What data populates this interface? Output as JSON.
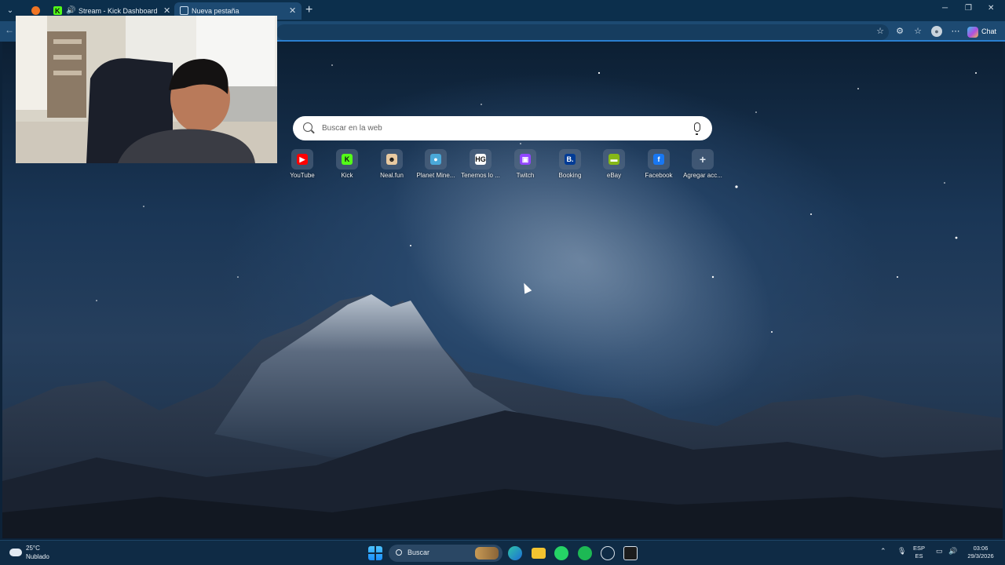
{
  "browser": {
    "tabs": [
      {
        "label": "",
        "favicon": "firefox-style-orange-icon"
      },
      {
        "label": "Stream - Kick Dashboard",
        "favicon": "kick-icon",
        "audio": "speaker-icon"
      },
      {
        "label": "Nueva pestaña",
        "favicon": "new-tab-page-icon",
        "active": true
      }
    ],
    "chat_label": "Chat"
  },
  "newtab": {
    "search_placeholder": "Buscar en la web",
    "shortcuts": [
      {
        "label": "YouTube",
        "icon": "youtube-icon",
        "color": "#ff0000",
        "glyph": "▶"
      },
      {
        "label": "Kick",
        "icon": "kick-icon",
        "color": "#53fc18",
        "glyph": "K"
      },
      {
        "label": "Neal.fun",
        "icon": "neal-fun-icon",
        "color": "#e8c9a0",
        "glyph": "☻"
      },
      {
        "label": "Planet Mine...",
        "icon": "planet-minecraft-icon",
        "color": "#4aa8d8",
        "glyph": "●"
      },
      {
        "label": "Tenemos lo ...",
        "icon": "tenemos-icon",
        "color": "#ffffff",
        "glyph": "HG"
      },
      {
        "label": "Twitch",
        "icon": "twitch-icon",
        "color": "#9146ff",
        "glyph": "▣"
      },
      {
        "label": "Booking",
        "icon": "booking-icon",
        "color": "#003b95",
        "glyph": "B."
      },
      {
        "label": "eBay",
        "icon": "ebay-icon",
        "color": "#86b817",
        "glyph": "▬"
      },
      {
        "label": "Facebook",
        "icon": "facebook-icon",
        "color": "#1877f2",
        "glyph": "f"
      },
      {
        "label": "Agregar acc...",
        "icon": "add-icon",
        "color": "transparent",
        "glyph": "+"
      }
    ]
  },
  "taskbar": {
    "weather_temp": "25°C",
    "weather_desc": "Nublado",
    "search_label": "Buscar",
    "lang_top": "ESP",
    "lang_bottom": "ES",
    "time": "03:06",
    "date": "29/3/2026"
  }
}
